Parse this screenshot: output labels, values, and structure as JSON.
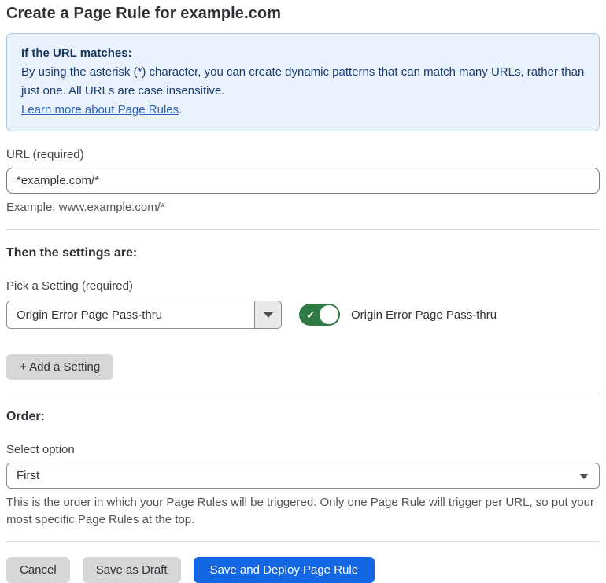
{
  "page": {
    "title": "Create a Page Rule for example.com"
  },
  "callout": {
    "heading": "If the URL matches:",
    "body": "By using the asterisk (*) character, you can create dynamic patterns that can match many URLs, rather than just one. All URLs are case insensitive.",
    "link_label": "Learn more about Page Rules",
    "link_suffix": "."
  },
  "url_field": {
    "label": "URL (required)",
    "value": "*example.com/*",
    "helper": "Example: www.example.com/*"
  },
  "settings": {
    "heading": "Then the settings are:",
    "picker_label": "Pick a Setting (required)",
    "picker_value": "Origin Error Page Pass-thru",
    "toggle_state": "on",
    "toggle_check_glyph": "✓",
    "toggle_label": "Origin Error Page Pass-thru",
    "add_button_label": "+ Add a Setting"
  },
  "order": {
    "heading": "Order:",
    "label": "Select option",
    "value": "First",
    "helper": "This is the order in which your Page Rules will be triggered. Only one Page Rule will trigger per URL, so put your most specific Page Rules at the top."
  },
  "footer": {
    "cancel_label": "Cancel",
    "save_draft_label": "Save as Draft",
    "save_deploy_label": "Save and Deploy Page Rule"
  },
  "colors": {
    "callout_bg": "#e9f1fb",
    "callout_border": "#a9c9ec",
    "callout_text": "#1b3d6e",
    "link": "#2c62b9",
    "toggle_on": "#2f7a43",
    "primary_button": "#1467e2",
    "gray_button": "#d7d7d7"
  }
}
